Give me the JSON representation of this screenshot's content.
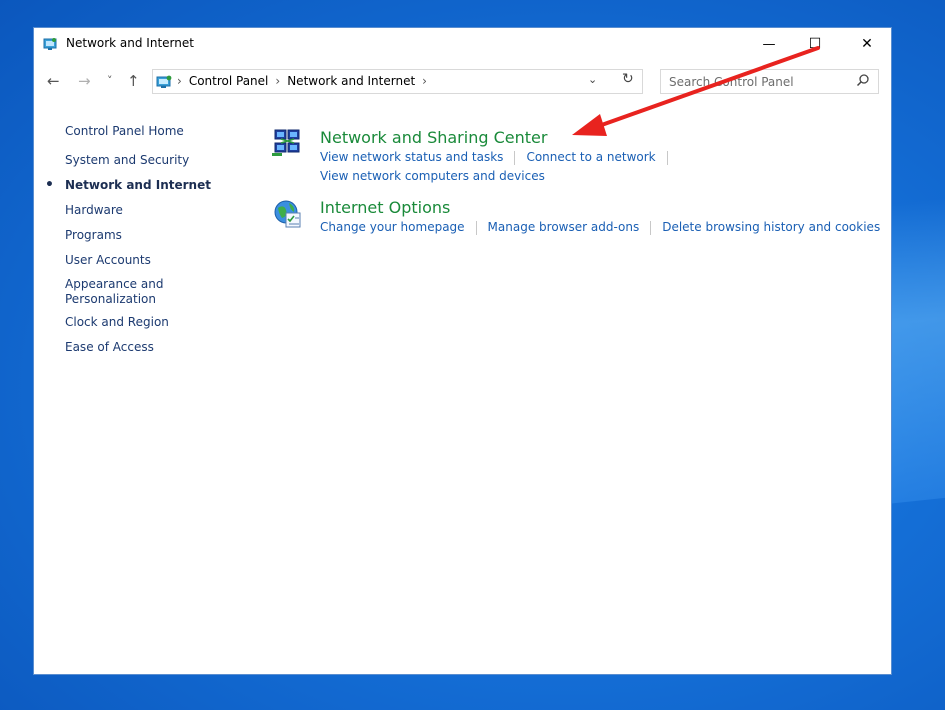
{
  "window": {
    "title": "Network and Internet",
    "controls": {
      "minimize": "—",
      "maximize": "☐",
      "close": "✕"
    }
  },
  "address_bar": {
    "back": "←",
    "forward": "→",
    "recent": "˅",
    "up": "↑",
    "crumbs": [
      "Control Panel",
      "Network and Internet"
    ],
    "separator": "›",
    "dropdown": "⌄",
    "refresh": "↻"
  },
  "search": {
    "placeholder": "Search Control Panel"
  },
  "sidebar": {
    "items": [
      {
        "label": "Control Panel Home"
      },
      {
        "label": "System and Security"
      },
      {
        "label": "Network and Internet",
        "active": true
      },
      {
        "label": "Hardware"
      },
      {
        "label": "Programs"
      },
      {
        "label": "User Accounts"
      },
      {
        "label": "Appearance and Personalization"
      },
      {
        "label": "Clock and Region"
      },
      {
        "label": "Ease of Access"
      }
    ]
  },
  "categories": [
    {
      "title": "Network and Sharing Center",
      "icon": "network-sharing-icon",
      "links": [
        "View network status and tasks",
        "Connect to a network",
        "View network computers and devices"
      ]
    },
    {
      "title": "Internet Options",
      "icon": "internet-options-icon",
      "links": [
        "Change your homepage",
        "Manage browser add-ons",
        "Delete browsing history and cookies"
      ]
    }
  ],
  "colors": {
    "category_title": "#1a8a3a",
    "link": "#1a5fb4",
    "sidebar_text": "#1c3a70",
    "annotation_arrow": "#e8231f",
    "desktop": "#1570d8"
  }
}
